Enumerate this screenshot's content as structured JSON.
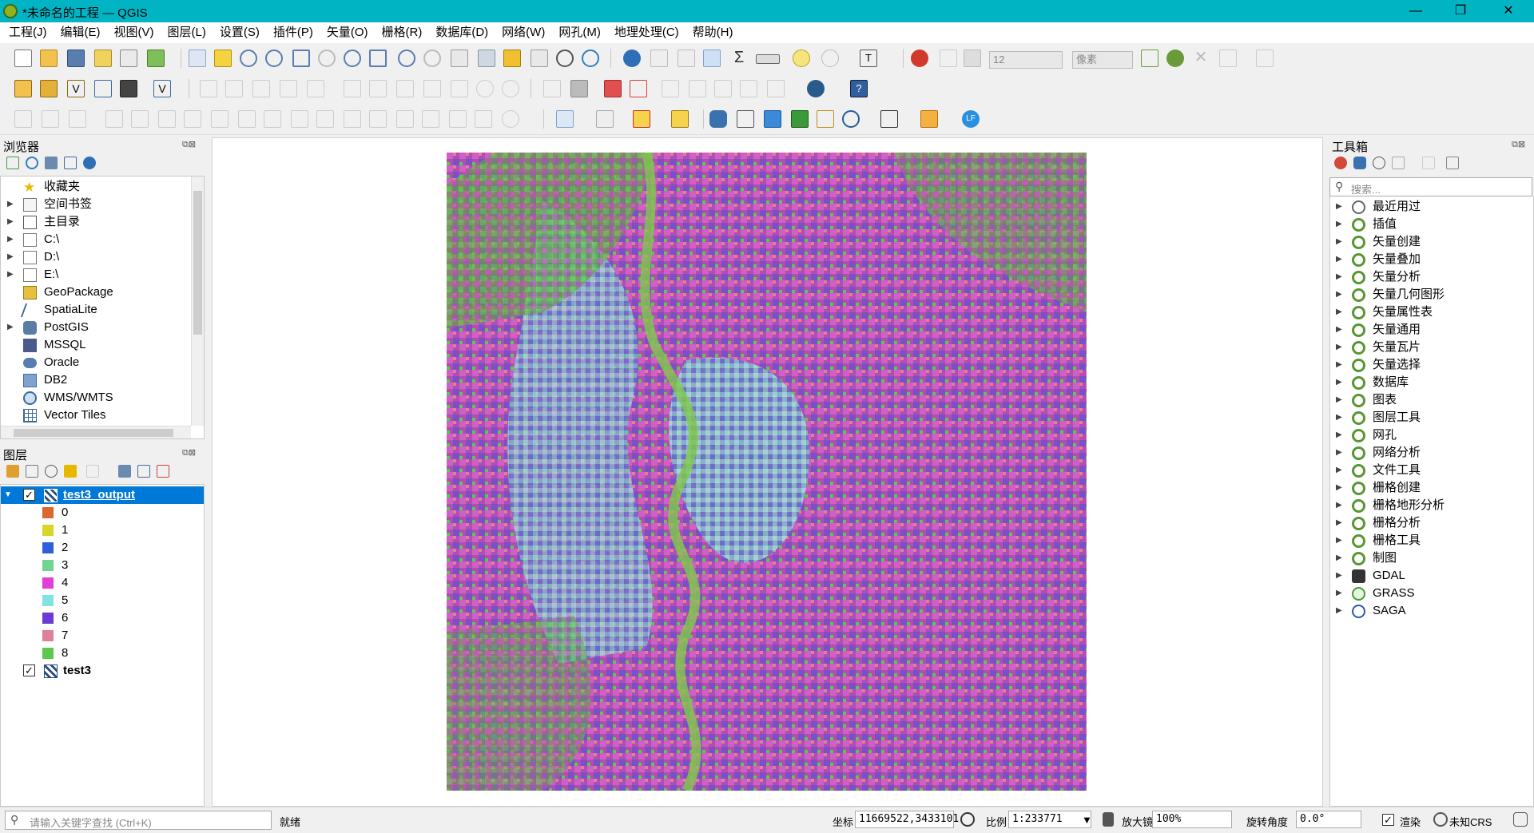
{
  "window": {
    "title": "*未命名的工程 — QGIS",
    "min_label": "—",
    "max_label": "❐",
    "close_label": "✕"
  },
  "menu": [
    "工程(J)",
    "编辑(E)",
    "视图(V)",
    "图层(L)",
    "设置(S)",
    "插件(P)",
    "矢量(O)",
    "栅格(R)",
    "数据库(D)",
    "网络(W)",
    "网孔(M)",
    "地理处理(C)",
    "帮助(H)"
  ],
  "toolbar": {
    "snap_tolerance": "12",
    "snap_unit": "像素"
  },
  "browser": {
    "title": "浏览器",
    "items": [
      {
        "label": "收藏夹",
        "icon": "star-icon",
        "expandable": false
      },
      {
        "label": "空间书签",
        "icon": "bookmark-icon",
        "expandable": true
      },
      {
        "label": "主目录",
        "icon": "home-icon",
        "expandable": true
      },
      {
        "label": "C:\\",
        "icon": "folder-icon",
        "expandable": true
      },
      {
        "label": "D:\\",
        "icon": "folder-icon",
        "expandable": true
      },
      {
        "label": "E:\\",
        "icon": "folder-icon",
        "expandable": true
      },
      {
        "label": "GeoPackage",
        "icon": "geopackage-icon",
        "expandable": false
      },
      {
        "label": "SpatiaLite",
        "icon": "spatialite-icon",
        "expandable": false
      },
      {
        "label": "PostGIS",
        "icon": "postgis-icon",
        "expandable": true
      },
      {
        "label": "MSSQL",
        "icon": "mssql-icon",
        "expandable": false
      },
      {
        "label": "Oracle",
        "icon": "oracle-icon",
        "expandable": false
      },
      {
        "label": "DB2",
        "icon": "db2-icon",
        "expandable": false
      },
      {
        "label": "WMS/WMTS",
        "icon": "globe-icon",
        "expandable": false
      },
      {
        "label": "Vector Tiles",
        "icon": "grid-icon",
        "expandable": false
      }
    ]
  },
  "layers": {
    "title": "图层",
    "layer1": {
      "name": "test3_output",
      "checked": true
    },
    "classes": [
      {
        "label": "0",
        "color": "#d9672e"
      },
      {
        "label": "1",
        "color": "#d7d72a"
      },
      {
        "label": "2",
        "color": "#2f5fd8"
      },
      {
        "label": "3",
        "color": "#6fd68f"
      },
      {
        "label": "4",
        "color": "#e03fd8"
      },
      {
        "label": "5",
        "color": "#7fe3e3"
      },
      {
        "label": "6",
        "color": "#6a3bd4"
      },
      {
        "label": "7",
        "color": "#e07f9a"
      },
      {
        "label": "8",
        "color": "#5dc94a"
      }
    ],
    "layer2": {
      "name": "test3",
      "checked": true
    }
  },
  "toolbox": {
    "title": "工具箱",
    "search_placeholder": "搜索...",
    "items": [
      {
        "label": "最近用过",
        "icon": "clock-icon"
      },
      {
        "label": "插值",
        "icon": "qgis-icon"
      },
      {
        "label": "矢量创建",
        "icon": "qgis-icon"
      },
      {
        "label": "矢量叠加",
        "icon": "qgis-icon"
      },
      {
        "label": "矢量分析",
        "icon": "qgis-icon"
      },
      {
        "label": "矢量几何图形",
        "icon": "qgis-icon"
      },
      {
        "label": "矢量属性表",
        "icon": "qgis-icon"
      },
      {
        "label": "矢量通用",
        "icon": "qgis-icon"
      },
      {
        "label": "矢量瓦片",
        "icon": "qgis-icon"
      },
      {
        "label": "矢量选择",
        "icon": "qgis-icon"
      },
      {
        "label": "数据库",
        "icon": "qgis-icon"
      },
      {
        "label": "图表",
        "icon": "qgis-icon"
      },
      {
        "label": "图层工具",
        "icon": "qgis-icon"
      },
      {
        "label": "网孔",
        "icon": "qgis-icon"
      },
      {
        "label": "网络分析",
        "icon": "qgis-icon"
      },
      {
        "label": "文件工具",
        "icon": "qgis-icon"
      },
      {
        "label": "栅格创建",
        "icon": "qgis-icon"
      },
      {
        "label": "栅格地形分析",
        "icon": "qgis-icon"
      },
      {
        "label": "栅格分析",
        "icon": "qgis-icon"
      },
      {
        "label": "栅格工具",
        "icon": "qgis-icon"
      },
      {
        "label": "制图",
        "icon": "qgis-icon"
      },
      {
        "label": "GDAL",
        "icon": "gdal-icon"
      },
      {
        "label": "GRASS",
        "icon": "grass-icon"
      },
      {
        "label": "SAGA",
        "icon": "saga-icon"
      }
    ]
  },
  "status": {
    "search_placeholder": "请输入关键字查找 (Ctrl+K)",
    "ready": "就绪",
    "coord_label": "坐标",
    "coord_value": "11669522,3433101",
    "scale_label": "比例",
    "scale_value": "1:233771",
    "magnifier_label": "放大镜",
    "magnifier_value": "100%",
    "rotation_label": "旋转角度",
    "rotation_value": "0.0°",
    "render_label": "渲染",
    "crs_label": "未知CRS"
  }
}
